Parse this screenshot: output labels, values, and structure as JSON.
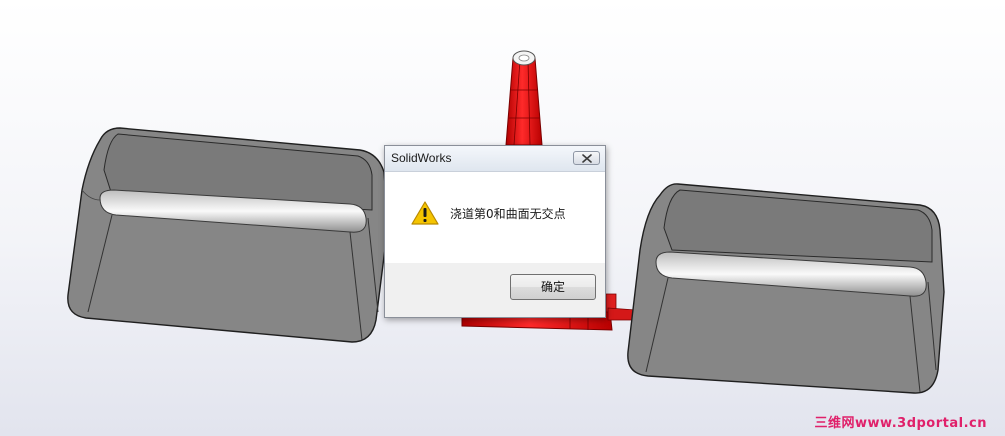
{
  "dialog": {
    "title": "SolidWorks",
    "message": "浇道第0和曲面无交点",
    "ok_label": "确定",
    "icon": "warning-icon"
  },
  "watermark": "三维网www.3dportal.cn",
  "colors": {
    "part_fill": "#878787",
    "sprue": "#e41010",
    "accent": "#e0206a"
  }
}
